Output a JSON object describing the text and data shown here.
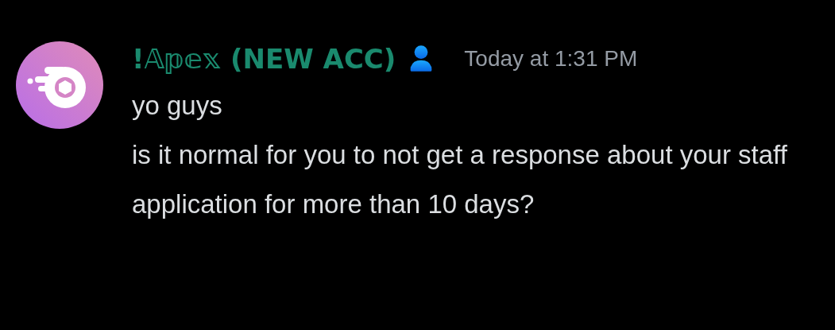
{
  "message": {
    "author": "!𝔸𝕡𝕖𝕩 (NEW ACC)",
    "timestamp": "Today at 1:31 PM",
    "lines": [
      "yo guys",
      "is it normal for you to not get a response about your staff application for more than 10 days?"
    ]
  }
}
